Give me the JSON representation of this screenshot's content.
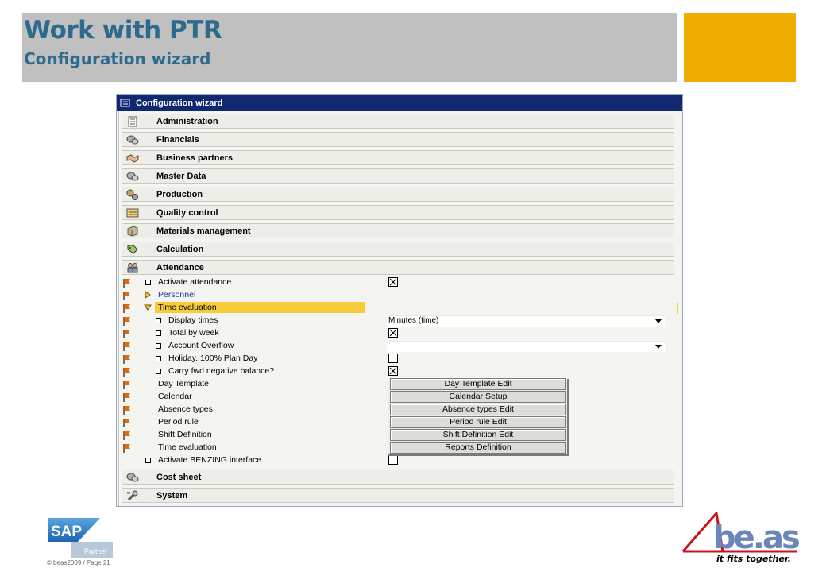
{
  "slide": {
    "title": "Work with PTR",
    "subtitle": "Configuration wizard",
    "accent_color": "#f0ac00",
    "title_color": "#2e6a8e"
  },
  "window": {
    "title": "Configuration wizard",
    "title_icon": "wizard-icon"
  },
  "sections_top": [
    {
      "label": "Administration",
      "icon": "document-icon"
    },
    {
      "label": "Financials",
      "icon": "coins-icon"
    },
    {
      "label": "Business partners",
      "icon": "handshake-icon"
    },
    {
      "label": "Master Data",
      "icon": "coins-icon"
    },
    {
      "label": "Production",
      "icon": "gears-icon"
    },
    {
      "label": "Quality control",
      "icon": "quality-icon"
    },
    {
      "label": "Materials management",
      "icon": "box-icon"
    },
    {
      "label": "Calculation",
      "icon": "tag-icon"
    },
    {
      "label": "Attendance",
      "icon": "people-icon"
    }
  ],
  "attendance_rows": [
    {
      "label": "Activate attendance",
      "control": "checkbox",
      "checked": true
    },
    {
      "label": "Personnel",
      "control": "none",
      "expander": "collapsed",
      "link": true
    },
    {
      "label": "Time evaluation",
      "control": "none",
      "expander": "expanded",
      "selected": true
    },
    {
      "label": "Display times",
      "control": "dropdown",
      "value": "Minutes (time)"
    },
    {
      "label": "Total by week",
      "control": "checkbox",
      "checked": true
    },
    {
      "label": "Account Overflow",
      "control": "dropdown",
      "value": ""
    },
    {
      "label": "Holiday, 100% Plan Day",
      "control": "checkbox",
      "checked": false
    },
    {
      "label": "Carry fwd negative balance?",
      "control": "checkbox",
      "checked": true
    },
    {
      "label": "Day Template",
      "control": "button",
      "button": "Day Template Edit"
    },
    {
      "label": "Calendar",
      "control": "button",
      "button": "Calendar Setup"
    },
    {
      "label": "Absence types",
      "control": "button",
      "button": "Absence types Edit"
    },
    {
      "label": "Period rule",
      "control": "button",
      "button": "Period rule Edit"
    },
    {
      "label": "Shift Definition",
      "control": "button",
      "button": "Shift Definition Edit"
    },
    {
      "label": "Time evaluation",
      "control": "button",
      "button": "Reports Definition"
    },
    {
      "label": "Activate BENZING interface",
      "control": "checkbox",
      "checked": false
    }
  ],
  "sections_bottom": [
    {
      "label": "Cost sheet",
      "icon": "coins-icon"
    },
    {
      "label": "System",
      "icon": "wrench-icon"
    }
  ],
  "footer": {
    "copyright": "© beas2009 / Page 21",
    "sap_logo_text": "SAP",
    "sap_partner_text": "Partner",
    "beas_logo_text": "be.as",
    "beas_tagline": "it fits together."
  }
}
